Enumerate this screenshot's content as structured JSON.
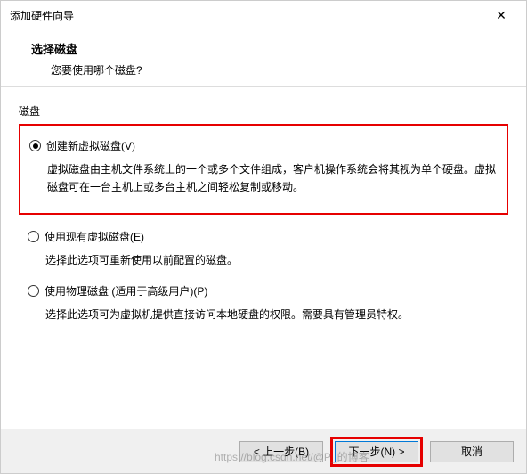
{
  "window": {
    "title": "添加硬件向导",
    "close_glyph": "✕"
  },
  "header": {
    "title": "选择磁盘",
    "subtitle": "您要使用哪个磁盘?"
  },
  "group_label": "磁盘",
  "options": [
    {
      "label": "创建新虚拟磁盘(V)",
      "desc": "虚拟磁盘由主机文件系统上的一个或多个文件组成，客户机操作系统会将其视为单个硬盘。虚拟磁盘可在一台主机上或多台主机之间轻松复制或移动。",
      "checked": true,
      "highlighted": true
    },
    {
      "label": "使用现有虚拟磁盘(E)",
      "desc": "选择此选项可重新使用以前配置的磁盘。",
      "checked": false,
      "highlighted": false
    },
    {
      "label": "使用物理磁盘 (适用于高级用户)(P)",
      "desc": "选择此选项可为虚拟机提供直接访问本地硬盘的权限。需要具有管理员特权。",
      "checked": false,
      "highlighted": false
    }
  ],
  "buttons": {
    "back": "< 上一步(B)",
    "next": "下一步(N) >",
    "cancel": "取消"
  },
  "watermark": "https://blog.csdn.net/@P_的博客"
}
